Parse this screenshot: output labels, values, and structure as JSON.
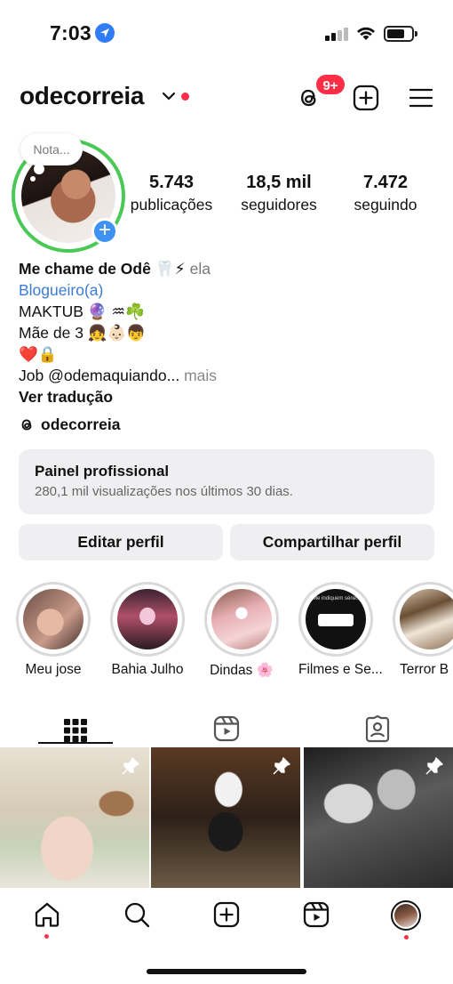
{
  "status_bar": {
    "time": "7:03"
  },
  "header": {
    "username": "odecorreia",
    "threads_badge": "9+"
  },
  "profile": {
    "note_label": "Nota...",
    "stats": [
      {
        "value": "5.743",
        "label": "publicações"
      },
      {
        "value": "18,5 mil",
        "label": "seguidores"
      },
      {
        "value": "7.472",
        "label": "seguindo"
      }
    ]
  },
  "bio": {
    "name": "Me chame de Odê 🦷⚡",
    "pronouns": "ela",
    "category": "Blogueiro(a)",
    "lines": [
      "MAKTUB 🔮 ♒☘️",
      "Mãe de 3 👧👶🏻👦",
      "❤️🔒"
    ],
    "job": "Job @odemaquiando...",
    "more": "mais",
    "translate": "Ver tradução",
    "threads_handle": "odecorreia"
  },
  "dashboard": {
    "title": "Painel profissional",
    "subtitle": "280,1 mil visualizações nos últimos 30 dias."
  },
  "buttons": {
    "edit": "Editar perfil",
    "share": "Compartilhar perfil"
  },
  "highlights": [
    {
      "label": "Meu jose"
    },
    {
      "label": "Bahia Julho"
    },
    {
      "label": "Dindas 🌸"
    },
    {
      "label": "Filmes e Se..."
    },
    {
      "label": "Terror B"
    }
  ],
  "highlight_story_text": "Me indiquem séries",
  "colors": {
    "accent_blue": "#3f92f2",
    "story_ring": "#4ac956",
    "notification_red": "#ff2d45"
  }
}
